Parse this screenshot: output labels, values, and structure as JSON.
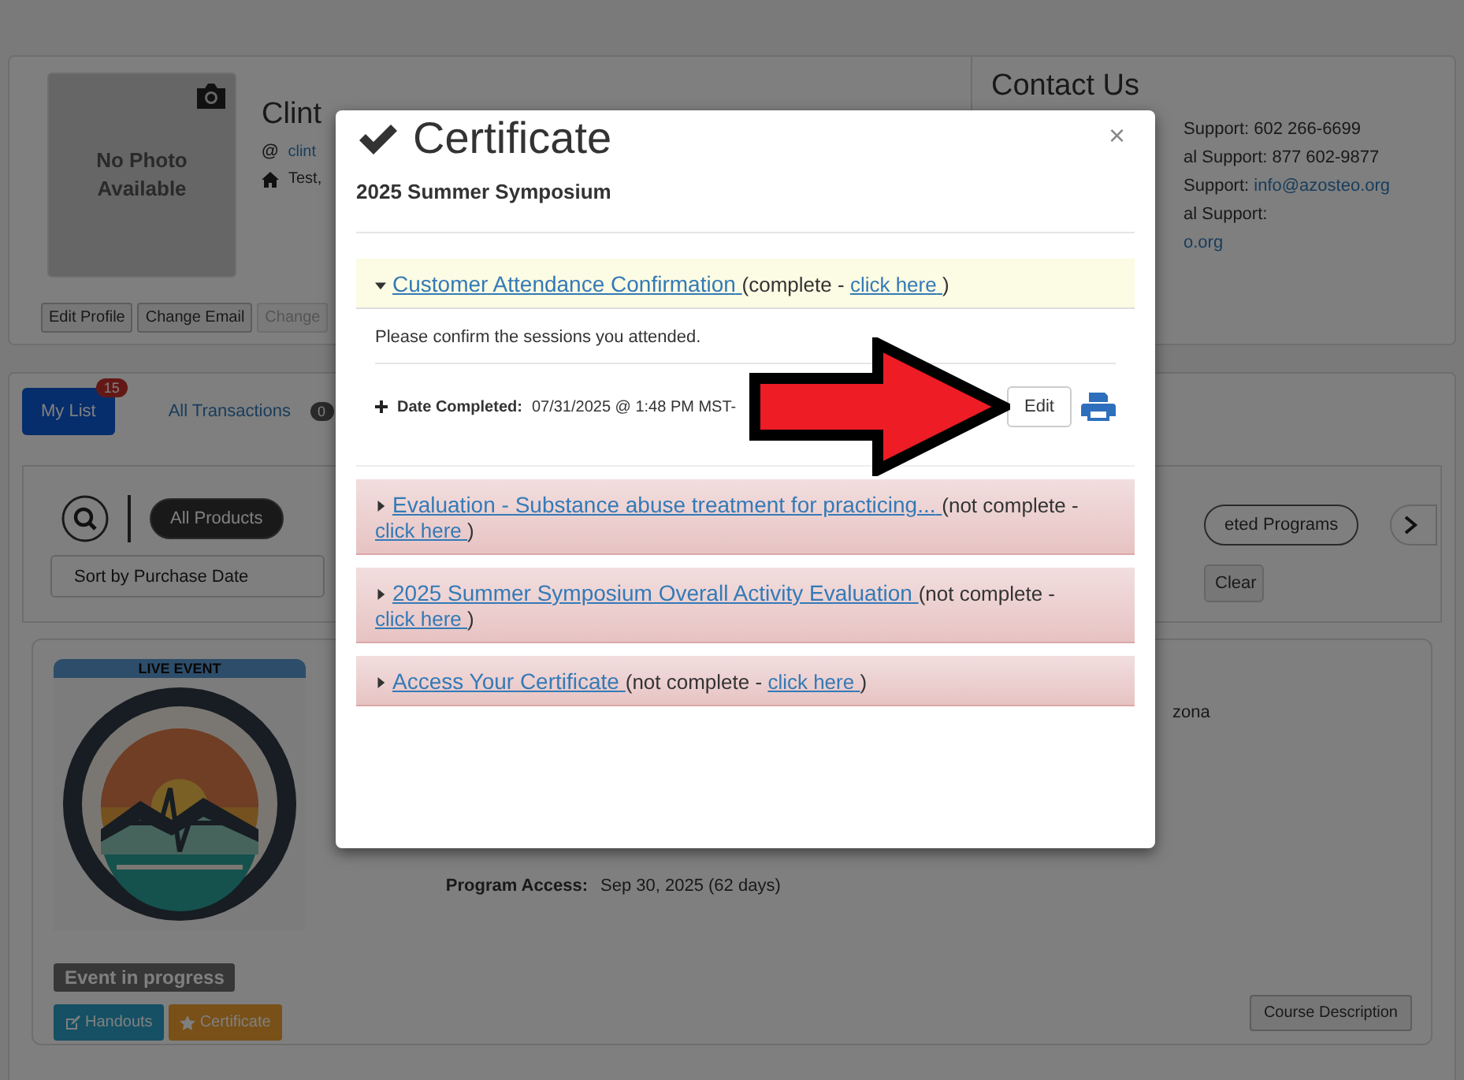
{
  "profile": {
    "photo_text": "No Photo Available",
    "name": "Clint",
    "email_icon": "@",
    "email": "clint",
    "address": "Test,",
    "buttons": [
      {
        "label": "Edit Profile",
        "disabled": false
      },
      {
        "label": "Change Email",
        "disabled": false
      },
      {
        "label": "Change",
        "disabled": true
      }
    ]
  },
  "contact": {
    "title": "Contact Us",
    "lines": [
      {
        "text": "Support: 602 266-6699"
      },
      {
        "text": "al Support: 877 602-9877"
      },
      {
        "text": "Support:",
        "link": "info@azosteo.org"
      },
      {
        "text": "al Support:"
      },
      {
        "link": "o.org"
      }
    ]
  },
  "tabs": [
    {
      "label": "My List",
      "badge": "15",
      "selected": true
    },
    {
      "label": "All Transactions",
      "badge": "0",
      "selected": false
    }
  ],
  "filters": {
    "pills": [
      {
        "label": "All Products",
        "selected": true
      },
      {
        "label": "eted Programs",
        "selected": false
      },
      {
        "selected": false
      }
    ],
    "sort": {
      "value": "Sort by Purchase Date"
    },
    "clear": "Clear"
  },
  "product": {
    "badge": "LIVE EVENT",
    "status": "Event in progress",
    "buttons": [
      {
        "label": "Handouts",
        "kind": "handouts"
      },
      {
        "label": "Certificate",
        "kind": "certificate"
      }
    ],
    "details": [
      {
        "label": "Program Access:",
        "value": "Sep 30, 2025 (62 days)"
      }
    ],
    "location": "zona",
    "description_button": "Course Description"
  },
  "modal": {
    "title": "Certificate",
    "close": "×",
    "subtitle": "2025 Summer Symposium",
    "sections": [
      {
        "title": "Customer Attendance Confirmation",
        "note": "(complete -",
        "link": "click here",
        "end": ")",
        "complete": true,
        "expanded": true,
        "body": {
          "text": "Please confirm the sessions you attended.",
          "label": "Date Completed:",
          "value": "07/31/2025 @ 1:48 PM MST-",
          "edit": "Edit"
        }
      },
      {
        "title": "Evaluation - Substance abuse treatment for practicing...",
        "note": "(not complete -",
        "link": "click here",
        "end": ")",
        "complete": false,
        "expanded": false
      },
      {
        "title": "2025 Summer Symposium Overall Activity Evaluation",
        "note": "(not complete -",
        "link": "click here",
        "end": ")",
        "complete": false,
        "expanded": false
      },
      {
        "title": "Access Your Certificate",
        "note": "(not complete -",
        "link": "click here",
        "end": ")",
        "complete": false,
        "expanded": false
      }
    ]
  }
}
